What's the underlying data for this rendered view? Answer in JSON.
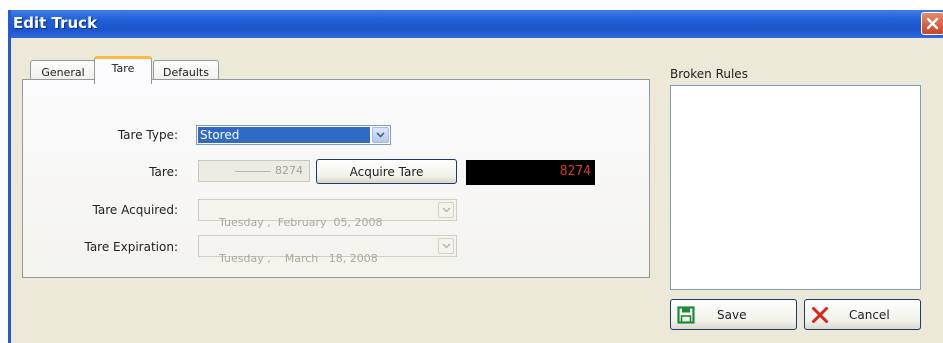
{
  "window": {
    "title": "Edit Truck"
  },
  "tabs": [
    {
      "label": "General",
      "active": false
    },
    {
      "label": "Tare",
      "active": true
    },
    {
      "label": "Defaults",
      "active": false
    }
  ],
  "tare_form": {
    "tare_type_label": "Tare Type:",
    "tare_type_value": "Stored",
    "tare_label": "Tare:",
    "tare_value": "8274",
    "acquire_button": "Acquire Tare",
    "tare_display": "8274",
    "acquired_label": "Tare Acquired:",
    "acquired_value": "Tuesday ,  February  05, 2008",
    "expiration_label": "Tare Expiration:",
    "expiration_value": "Tuesday ,    March   18, 2008"
  },
  "broken_rules": {
    "label": "Broken Rules"
  },
  "buttons": {
    "save": "Save",
    "cancel": "Cancel"
  },
  "colors": {
    "title_bar": "#1f5fd8",
    "selection": "#316ac5",
    "display_bg": "#000000",
    "display_text": "#d23a2a",
    "save_icon": "#1e8a3a",
    "cancel_icon": "#d8261c"
  }
}
